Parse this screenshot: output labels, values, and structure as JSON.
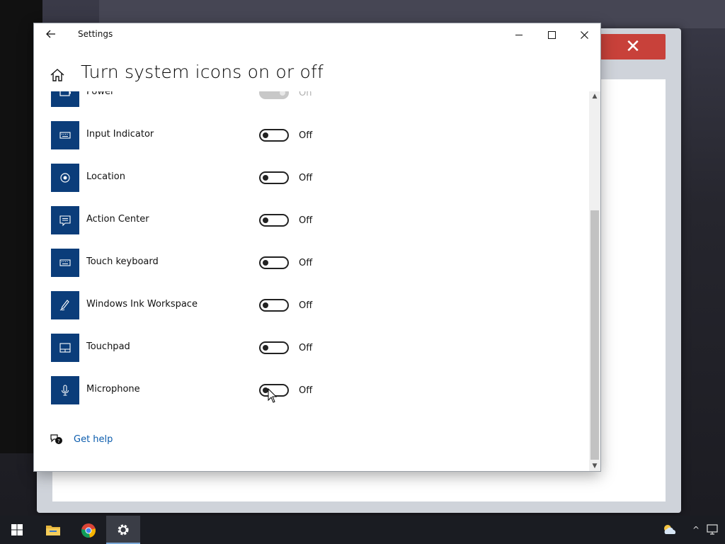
{
  "window": {
    "title": "Settings",
    "page_title": "Turn system icons on or off"
  },
  "items": [
    {
      "label": "Power",
      "state": "On",
      "icon": "battery-icon",
      "disabled": true
    },
    {
      "label": "Input Indicator",
      "state": "Off",
      "icon": "keyboard-icon",
      "disabled": false
    },
    {
      "label": "Location",
      "state": "Off",
      "icon": "location-icon",
      "disabled": false
    },
    {
      "label": "Action Center",
      "state": "Off",
      "icon": "action-center-icon",
      "disabled": false
    },
    {
      "label": "Touch keyboard",
      "state": "Off",
      "icon": "keyboard-icon",
      "disabled": false
    },
    {
      "label": "Windows Ink Workspace",
      "state": "Off",
      "icon": "pen-icon",
      "disabled": false
    },
    {
      "label": "Touchpad",
      "state": "Off",
      "icon": "touchpad-icon",
      "disabled": false
    },
    {
      "label": "Microphone",
      "state": "Off",
      "icon": "microphone-icon",
      "disabled": false
    }
  ],
  "help": {
    "label": "Get help"
  },
  "background": {
    "close_glyph": "✕"
  },
  "colors": {
    "accent_tile": "#0b3d7a",
    "link": "#0b5cad"
  },
  "taskbar": {
    "apps": [
      "windows-start-icon",
      "file-explorer-icon",
      "chrome-icon",
      "settings-icon"
    ],
    "active": "settings-icon"
  }
}
